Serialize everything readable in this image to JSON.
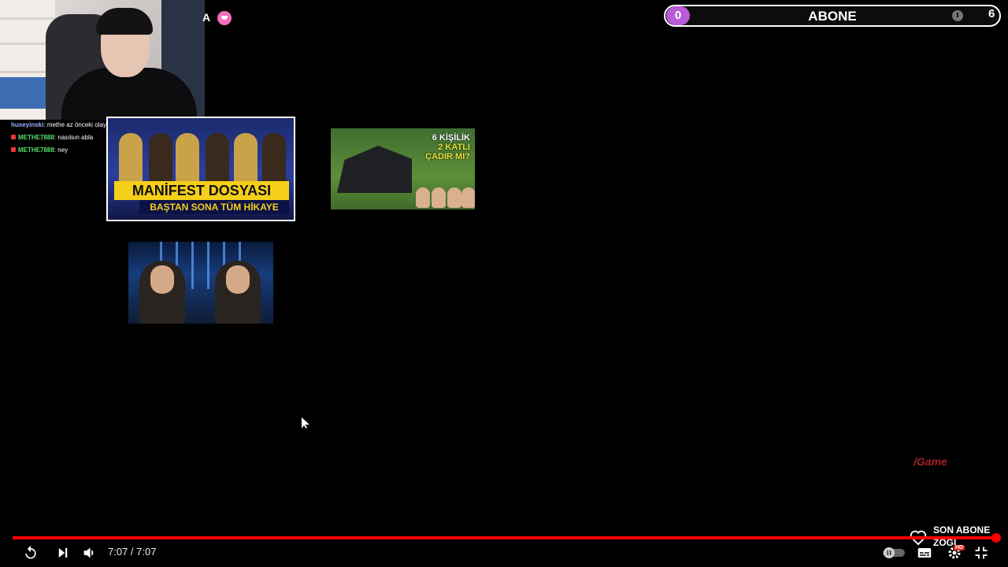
{
  "overlay": {
    "alert_letter": "A",
    "subscribe_goal": {
      "current": "0",
      "label": "ABONE",
      "target": "6"
    },
    "watermark": "/Game"
  },
  "chat": [
    {
      "user": "huseyinski",
      "message": "methe az önceki olay sarmıdı"
    },
    {
      "user": "METHE7888",
      "message": "nasılsın abla"
    },
    {
      "user": "METHE7888",
      "message": "ney"
    }
  ],
  "thumbnails": {
    "t1": {
      "line1": "MANİFEST DOSYASI",
      "line2": "BAŞTAN SONA TÜM HİKAYE"
    },
    "t2": {
      "line1": "6 KİŞİLİK",
      "line2": "2 KATLI",
      "line3": "ÇADIR MI?"
    }
  },
  "son_abone": {
    "label": "SON ABONE",
    "name": "ZOGI"
  },
  "player": {
    "time": "7:07 / 7:07",
    "progress": 1.0,
    "hd_badge": "HD"
  },
  "colors": {
    "progress": "#ff0000",
    "goal_count": "#b85bd9",
    "chat_user": "#55e06b"
  }
}
